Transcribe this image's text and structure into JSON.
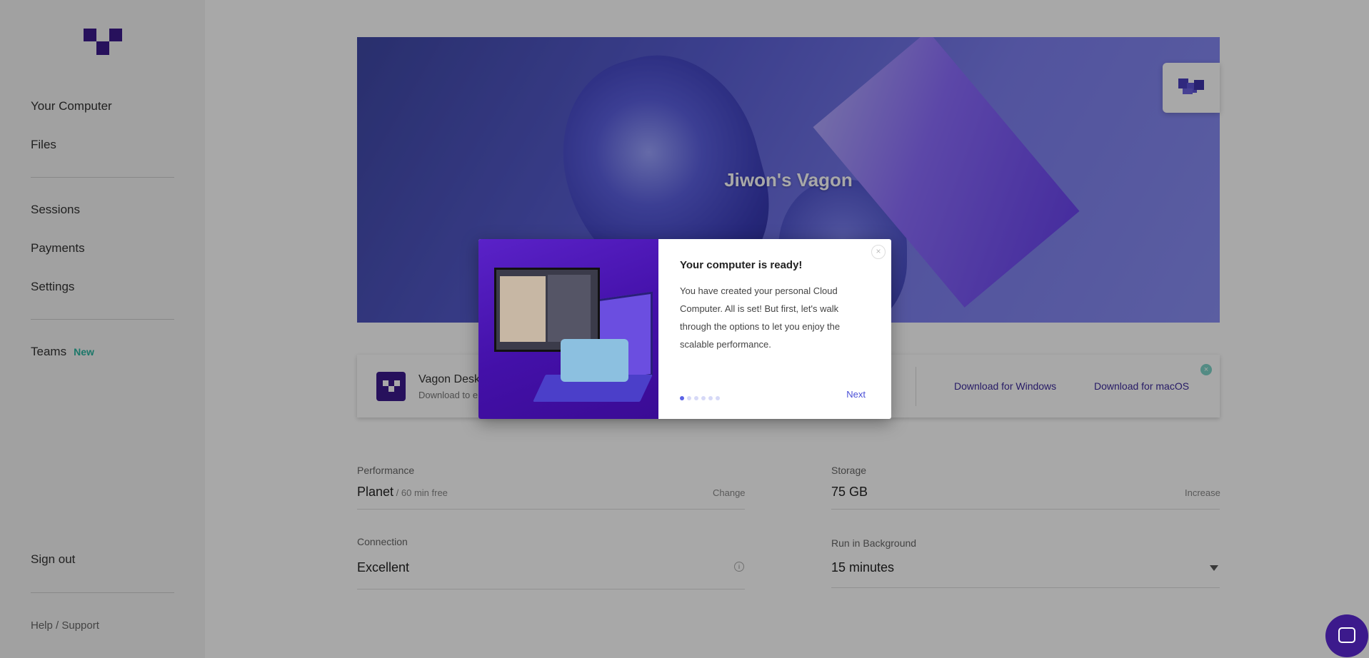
{
  "sidebar": {
    "items": [
      {
        "label": "Your Computer"
      },
      {
        "label": "Files"
      },
      {
        "label": "Sessions"
      },
      {
        "label": "Payments"
      },
      {
        "label": "Settings"
      },
      {
        "label": "Teams",
        "badge": "New"
      }
    ],
    "sign_out": "Sign out",
    "help": "Help / Support"
  },
  "banner": {
    "title": "Jiwon's Vagon"
  },
  "download": {
    "title": "Vagon Desk",
    "subtitle": "Download to e",
    "windows": "Download for Windows",
    "macos": "Download for macOS"
  },
  "fields": {
    "performance": {
      "label": "Performance",
      "value": "Planet",
      "sub": " / 60 min free",
      "action": "Change"
    },
    "storage": {
      "label": "Storage",
      "value": "75 GB",
      "action": "Increase"
    },
    "connection": {
      "label": "Connection",
      "value": "Excellent",
      "info_icon": "info-icon"
    },
    "background": {
      "label": "Run in Background",
      "value": "15 minutes",
      "dropdown_icon": "caret-down-icon"
    }
  },
  "modal": {
    "title": "Your computer is ready!",
    "body": "You have created your personal Cloud Computer. All is set! But first, let's walk through the options to let you enjoy the scalable performance.",
    "next": "Next",
    "steps": 6,
    "current_step": 1
  },
  "colors": {
    "brand": "#3c1a8c",
    "accent": "#4a4fd6",
    "badge": "#2bb5a0"
  }
}
